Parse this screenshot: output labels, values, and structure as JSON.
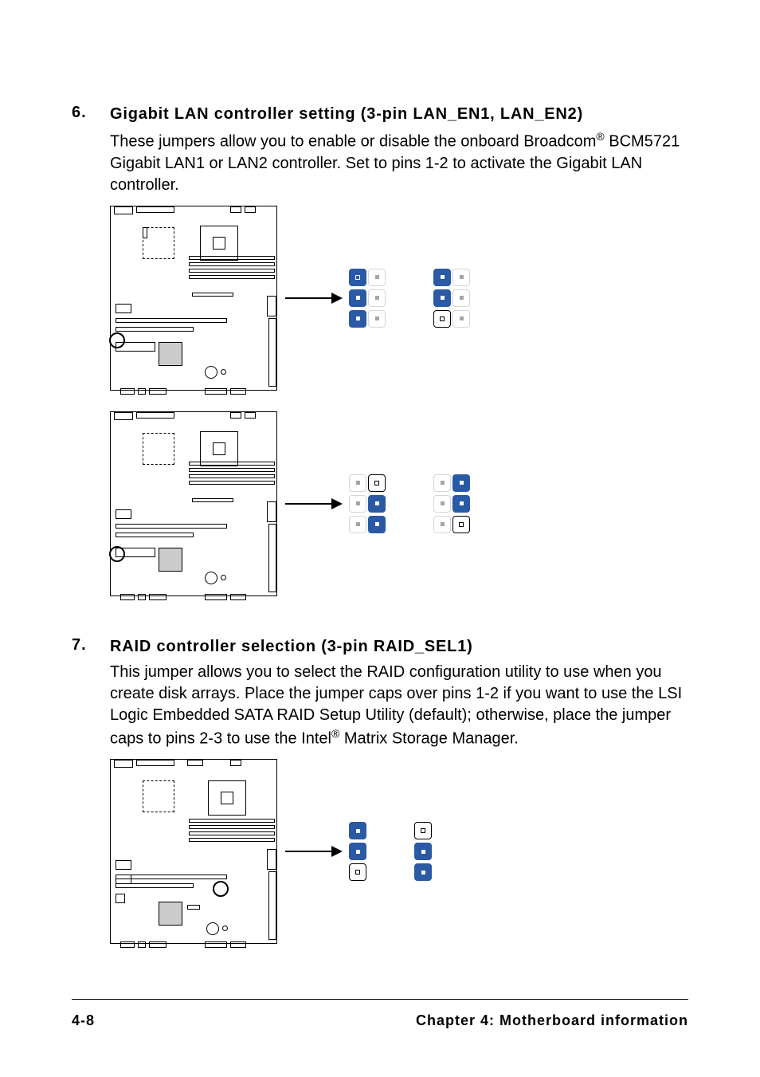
{
  "sections": {
    "s6": {
      "number": "6.",
      "title": "Gigabit LAN controller setting (3-pin LAN_EN1, LAN_EN2)",
      "body_pre": "These jumpers allow you to enable or disable the onboard Broadcom",
      "body_post": " BCM5721 Gigabit LAN1 or LAN2 controller. Set to pins 1-2 to activate the Gigabit LAN controller."
    },
    "s7": {
      "number": "7.",
      "title": "RAID controller selection (3-pin RAID_SEL1)",
      "body_pre": "This jumper allows you to select the RAID configuration utility to use when you create disk arrays. Place the jumper caps over pins 1-2 if you want to use the LSI Logic Embedded SATA RAID Setup Utility (default); otherwise, place the jumper caps to pins 2-3 to use the Intel",
      "body_post": " Matrix Storage Manager."
    }
  },
  "footer": {
    "page": "4-8",
    "chapter": "Chapter 4:  Motherboard information"
  }
}
